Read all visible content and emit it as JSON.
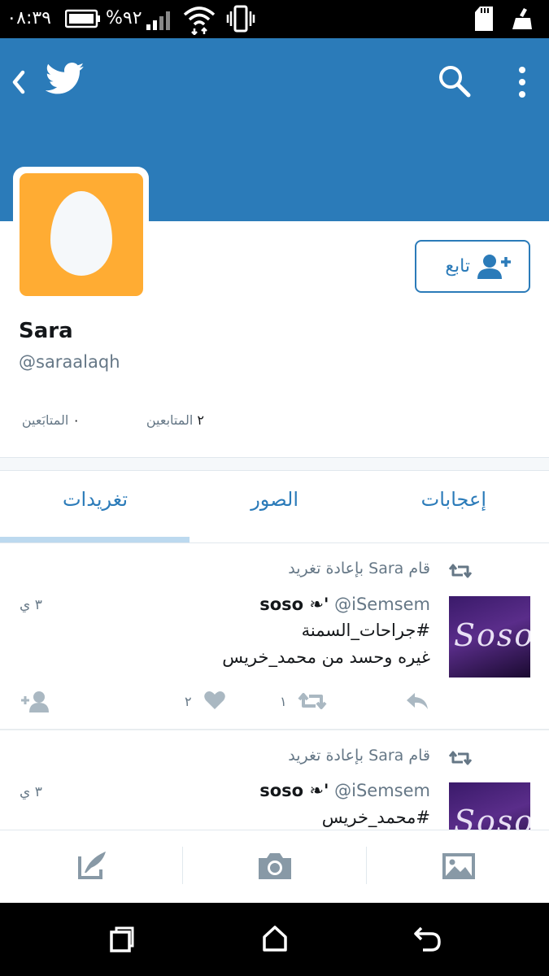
{
  "status_bar": {
    "time": "٠٨:٣٩",
    "battery_percent": "%٩٢"
  },
  "header": {
    "back_icon": "chevron-left-icon",
    "logo": "twitter-bird-icon",
    "search_icon": "search-icon",
    "menu_icon": "more-vertical-icon"
  },
  "profile": {
    "name": "Sara",
    "handle": "@saraalaqh",
    "follow_label": "تابع",
    "following_count": "٢",
    "following_label": "المتابعين",
    "followers_count": "٠",
    "followers_label": "المتابَعين"
  },
  "tabs": [
    {
      "label": "تغريدات",
      "active": true
    },
    {
      "label": "الصور",
      "active": false
    },
    {
      "label": "إعجابات",
      "active": false
    }
  ],
  "tweets": [
    {
      "retweet_label": "قام Sara بإعادة تغريد",
      "author_name": "soso ❧'",
      "author_handle": "@iSemsem",
      "thumb_text": "Soso",
      "lines": [
        "#جراحات_السمنة",
        "غيره وحسد من محمد_خريس"
      ],
      "time": "٣ ي",
      "retweets": "١",
      "likes": "٢"
    },
    {
      "retweet_label": "قام Sara بإعادة تغريد",
      "author_name": "soso ❧'",
      "author_handle": "@iSemsem",
      "thumb_text": "Soso",
      "lines": [
        "#محمد_خريس"
      ],
      "time": "٣ ي"
    }
  ],
  "toolbar": {
    "compose_icon": "compose-icon",
    "camera_icon": "camera-icon",
    "gallery_icon": "image-icon"
  },
  "colors": {
    "brand": "#2b7bb9",
    "avatar_bg": "#ffac33"
  }
}
